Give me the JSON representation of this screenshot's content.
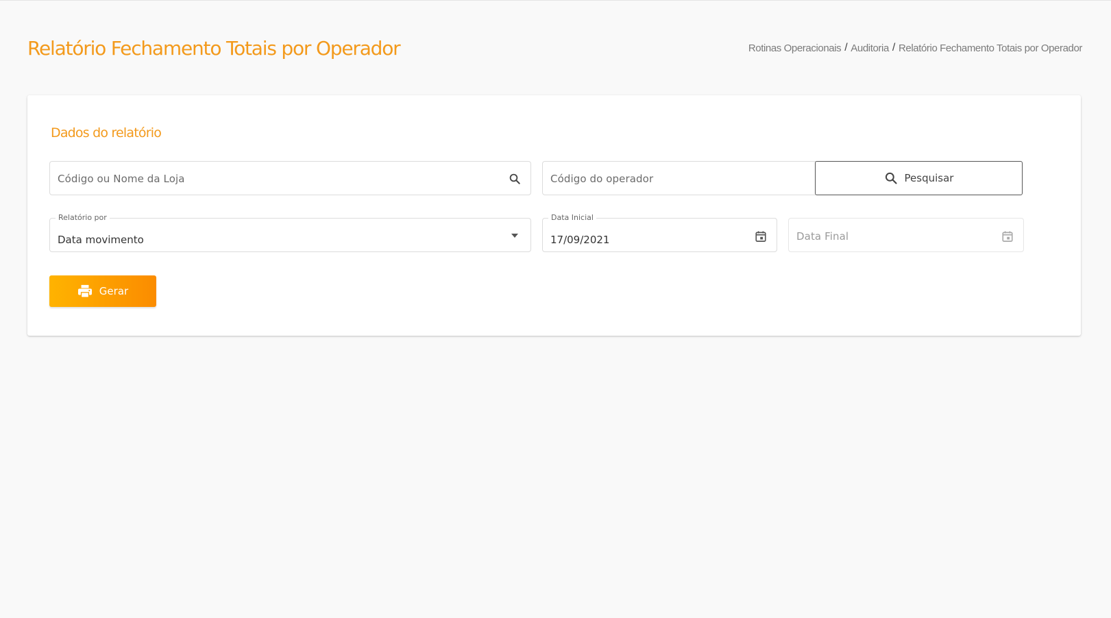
{
  "header": {
    "title": "Relatório Fechamento Totais por Operador",
    "breadcrumb": [
      {
        "label": "Rotinas Operacionais"
      },
      {
        "label": "Auditoria"
      },
      {
        "label": "Relatório Fechamento Totais por Operador"
      }
    ],
    "breadcrumb_separator": "/"
  },
  "form": {
    "section_title": "Dados do relatório",
    "store_search": {
      "placeholder": "Código ou Nome da Loja",
      "icon": "search-icon"
    },
    "operator_code": {
      "placeholder": "Código do operador"
    },
    "search_button": {
      "label": "Pesquisar",
      "icon": "search-icon"
    },
    "report_by": {
      "label": "Relatório por",
      "value": "Data movimento",
      "icon": "dropdown-arrow-icon"
    },
    "start_date": {
      "label": "Data Inicial",
      "value": "17/09/2021",
      "icon": "calendar-icon"
    },
    "end_date": {
      "placeholder": "Data Final",
      "icon": "calendar-icon"
    },
    "generate_button": {
      "label": "Gerar",
      "icon": "printer-icon"
    }
  },
  "colors": {
    "accent": "#f39a1c",
    "button_gradient_start": "#ffb300",
    "button_gradient_end": "#fb8c00",
    "background": "#f9f9f9"
  }
}
